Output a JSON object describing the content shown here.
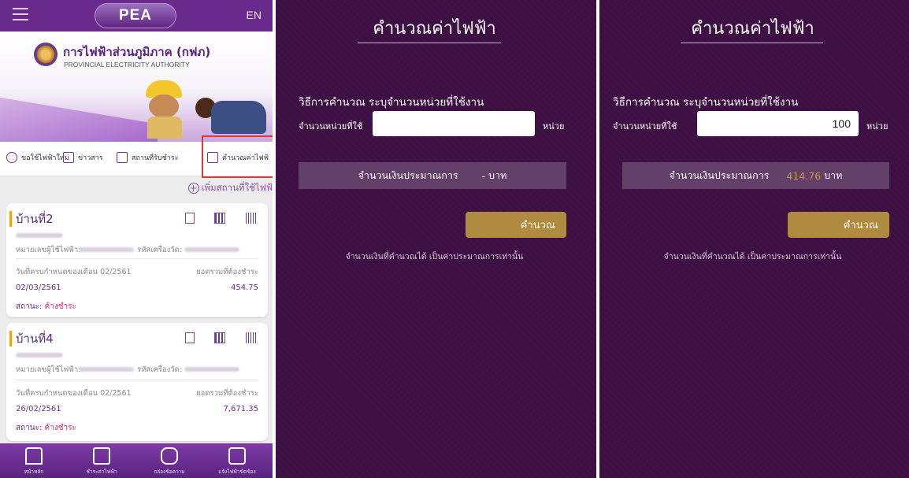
{
  "screen1": {
    "header": {
      "logo_text": "PEA",
      "lang_button": "EN"
    },
    "banner": {
      "org_name_th": "การไฟฟ้าส่วนภูมิภาค (กฟภ)",
      "org_name_en": "PROVINCIAL ELECTRICITY AUTHORITY"
    },
    "quicknav": [
      {
        "label": "ขอใช้ไฟฟ้าใหม่",
        "icon": "bulb-icon"
      },
      {
        "label": "ข่าวสาร",
        "icon": "news-icon"
      },
      {
        "label": "สถานที่รับชำระ",
        "icon": "cashier-icon"
      },
      {
        "label": "คำนวณค่าไฟฟ้",
        "icon": "calculator-icon"
      }
    ],
    "add_place_label": "เพิ่มสถานที่ใช้ไฟฟ้",
    "cards": [
      {
        "name": "บ้านที่2",
        "account_label": "หมายเลขผู้ใช้ไฟฟ้า:",
        "meter_label": "รหัสเครื่องวัด:",
        "due_label": "วันที่ครบกำหนดของเดือน 02/2561",
        "total_label": "ยอดรวมที่ต้องชำระ",
        "date": "02/03/2561",
        "amount": "454.75",
        "status_label": "สถานะ:",
        "status_value": "ค้างชำระ"
      },
      {
        "name": "บ้านที่4",
        "account_label": "หมายเลขผู้ใช้ไฟฟ้า:",
        "meter_label": "รหัสเครื่องวัด:",
        "due_label": "วันที่ครบกำหนดของเดือน 02/2561",
        "total_label": "ยอดรวมที่ต้องชำระ",
        "date": "26/02/2561",
        "amount": "7,671.35",
        "status_label": "สถานะ:",
        "status_value": "ค้างชำระ"
      }
    ],
    "tabbar": [
      {
        "label": "หน้าหลัก",
        "icon": "home-icon"
      },
      {
        "label": "ชำระค่าไฟฟ้า",
        "icon": "wallet-icon"
      },
      {
        "label": "กล่องข้อความ",
        "icon": "message-icon"
      },
      {
        "label": "แจ้งไฟฟ้าขัดข้อง",
        "icon": "outage-icon"
      }
    ]
  },
  "screen2": {
    "title": "คำนวณค่าไฟฟ้า",
    "method": "วิธีการคำนวณ ระบุจำนวนหน่วยที่ใช้งาน",
    "units_label": "จำนวนหน่วยที่ใช้",
    "units_value": "",
    "unit_suffix": "หน่วย",
    "result_label": "จำนวนเงินประมาณการ",
    "result_value": "-",
    "result_currency": "บาท",
    "button": "คำนวณ",
    "note": "จำนวนเงินที่คำนวณได้ เป็นค่าประมาณการเท่านั้น"
  },
  "screen3": {
    "title": "คำนวณค่าไฟฟ้า",
    "method": "วิธีการคำนวณ ระบุจำนวนหน่วยที่ใช้งาน",
    "units_label": "จำนวนหน่วยที่ใช้",
    "units_value": "100",
    "unit_suffix": "หน่วย",
    "result_label": "จำนวนเงินประมาณการ",
    "result_value": "414.76",
    "result_currency": "บาท",
    "button": "คำนวณ",
    "note": "จำนวนเงินที่คำนวณได้ เป็นค่าประมาณการเท่านั้น"
  },
  "colors": {
    "purple": "#6a2a8c",
    "dark_bg": "#3d0f43",
    "gold": "#b08a3e",
    "status_pink": "#e0227a"
  }
}
